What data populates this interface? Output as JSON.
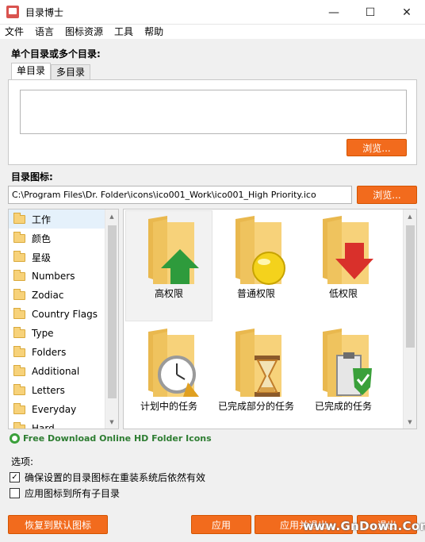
{
  "window": {
    "title": "目录博士",
    "minimize_glyph": "—",
    "maximize_glyph": "☐",
    "close_glyph": "✕"
  },
  "menu": [
    "文件",
    "语言",
    "图标资源",
    "工具",
    "帮助"
  ],
  "directories": {
    "label": "单个目录或多个目录:",
    "tabs": [
      "单目录",
      "多目录"
    ],
    "active_tab": "单目录",
    "value": "",
    "browse_label": "浏览..."
  },
  "folder_icon": {
    "label": "目录图标:",
    "path": "C:\\Program Files\\Dr. Folder\\icons\\ico001_Work\\ico001_High Priority.ico",
    "browse_label": "浏览..."
  },
  "categories": [
    "工作",
    "颜色",
    "星级",
    "Numbers",
    "Zodiac",
    "Country Flags",
    "Type",
    "Folders",
    "Additional",
    "Letters",
    "Everyday",
    "Hard..."
  ],
  "selected_category": "工作",
  "icons": [
    {
      "caption": "高权限",
      "badge": "arrow-up-icon",
      "color": "#2e9b3c"
    },
    {
      "caption": "普通权限",
      "badge": "circle-icon",
      "color": "#f4d21c"
    },
    {
      "caption": "低权限",
      "badge": "arrow-down-icon",
      "color": "#d9302b"
    },
    {
      "caption": "计划中的任务",
      "badge": "alarm-clock-icon",
      "color": "#cfcfcf"
    },
    {
      "caption": "已完成部分的任务",
      "badge": "hourglass-icon",
      "color": "#c07c2a"
    },
    {
      "caption": "已完成的任务",
      "badge": "clipboard-check-icon",
      "color": "#3aa03a"
    }
  ],
  "selected_icon": "高权限",
  "download_link": "Free Download Online HD Folder Icons",
  "options": {
    "label": "选项:",
    "items": [
      {
        "label": "确保设置的目录图标在重装系统后依然有效",
        "checked": true
      },
      {
        "label": "应用图标到所有子目录",
        "checked": false
      }
    ]
  },
  "footer": {
    "restore_label": "恢复到默认图标",
    "apply_label": "应用",
    "apply_close_label": "应用并退出",
    "exit_label": "退出"
  },
  "watermark": "www.GnDown.Com",
  "colors": {
    "accent": "#f26b1d",
    "folder_yellow": "#f7d27a",
    "link_green": "#2e7d32"
  }
}
